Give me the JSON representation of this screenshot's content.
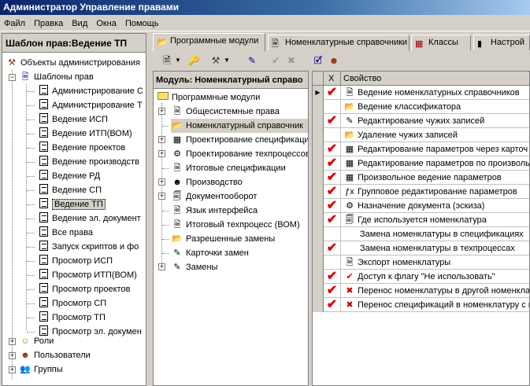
{
  "window": {
    "title": "Администратор Управление правами"
  },
  "menu": [
    "Файл",
    "Правка",
    "Вид",
    "Окна",
    "Помощь"
  ],
  "left_panel": {
    "header": "Шаблон прав:Ведение ТП",
    "root": "Объекты администрирования",
    "templates_label": "Шаблоны прав",
    "templates": [
      "Администрирование С",
      "Администрирование Т",
      "Ведение ИСП",
      "Ведение ИТП(ВОМ)",
      "Ведение проектов",
      "Ведение производств",
      "Ведение РД",
      "Ведение СП",
      "Ведение ТП",
      "Ведение эл. документ",
      "Все права",
      "Запуск скриптов и фо",
      "Просмотр ИСП",
      "Просмотр ИТП(ВОМ)",
      "Просмотр проектов",
      "Просмотр СП",
      "Просмотр ТП",
      "Просмотр эл. докумен"
    ],
    "selected_template": "Ведение ТП",
    "others": [
      "Роли",
      "Пользователи",
      "Группы"
    ]
  },
  "tabs": [
    {
      "label": "Программные модули",
      "active": true
    },
    {
      "label": "Номенклатурные справочники",
      "active": false
    },
    {
      "label": "Классы",
      "active": false
    },
    {
      "label": "Настрой",
      "active": false
    }
  ],
  "module_panel": {
    "header": "Модуль: Номенклатурный справо",
    "root": "Программные модули",
    "items": [
      "Общесистемные права",
      "Номенклатурный справочник",
      "Проектирование спецификаций",
      "Проектирование техпроцессов",
      "Итоговые спецификации",
      "Производство",
      "Документооборот",
      "Язык интерфейса",
      "Итоговый техпроцесс (ВОМ)",
      "Разрешенные замены",
      "Карточки замен",
      "Замены"
    ]
  },
  "grid": {
    "col_check": "X",
    "col_property": "Свойство",
    "rows": [
      {
        "checked": true,
        "text": "Ведение номенклатурных справочников"
      },
      {
        "checked": false,
        "text": "Ведение классификатора"
      },
      {
        "checked": true,
        "text": "Редактирование чужих записей"
      },
      {
        "checked": false,
        "text": "Удаление чужих записей"
      },
      {
        "checked": true,
        "text": "Редактирование параметров через карточ"
      },
      {
        "checked": true,
        "text": "Редактирование параметров по произволь"
      },
      {
        "checked": true,
        "text": "Произвольное ведение параметров"
      },
      {
        "checked": true,
        "text": "Групповое редактирование параметров"
      },
      {
        "checked": true,
        "text": "Назначение документа (эскиза)"
      },
      {
        "checked": true,
        "text": "Где используется номенклатура"
      },
      {
        "checked": false,
        "text": "Замена номенклатуры в спецификациях"
      },
      {
        "checked": true,
        "text": "Замена номенклатуры в техпроцессах"
      },
      {
        "checked": false,
        "text": "Экспорт номенклатуры"
      },
      {
        "checked": true,
        "text": "Доступ к флагу \"Не использовать\""
      },
      {
        "checked": true,
        "text": "Перенос номенклатуры в другой номенклат"
      },
      {
        "checked": true,
        "text": "Перенос спецификаций в номенклатуру с н"
      }
    ]
  },
  "checkmark": "✔",
  "colors": {
    "title_start": "#0a246a",
    "title_end": "#a6caf0",
    "check": "#e00000",
    "face": "#d4d0c8"
  }
}
